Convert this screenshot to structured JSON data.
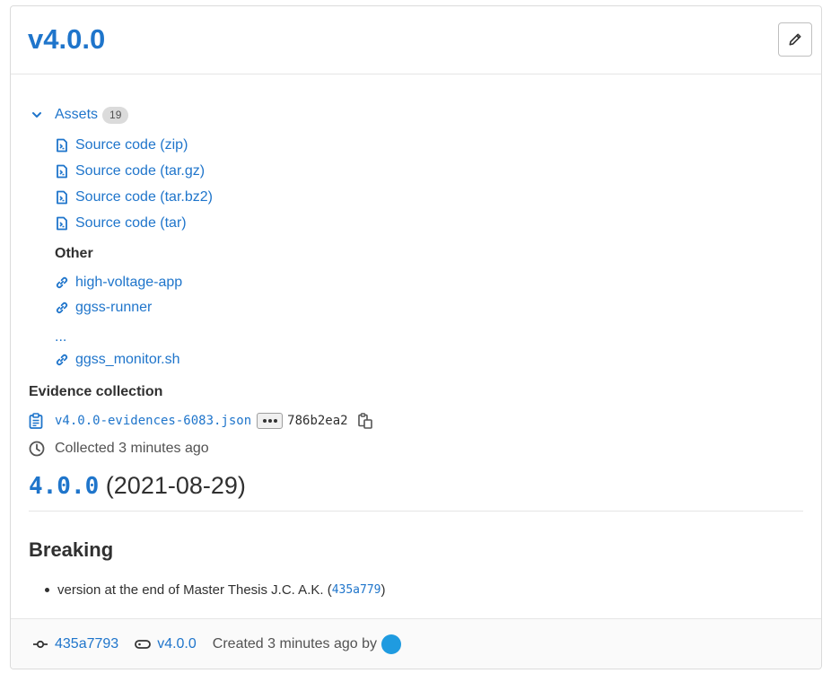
{
  "release": {
    "title": "v4.0.0",
    "edit_icon": "pencil-icon"
  },
  "assets": {
    "label": "Assets",
    "count": "19",
    "sources": [
      {
        "label": "Source code (zip)",
        "icon": "doc-code-icon"
      },
      {
        "label": "Source code (tar.gz)",
        "icon": "doc-code-icon"
      },
      {
        "label": "Source code (tar.bz2)",
        "icon": "doc-code-icon"
      },
      {
        "label": "Source code (tar)",
        "icon": "doc-code-icon"
      }
    ],
    "other_heading": "Other",
    "links": [
      {
        "label": "high-voltage-app",
        "icon": "link-icon"
      },
      {
        "label": "ggss-runner",
        "icon": "link-icon"
      },
      {
        "label": "ggss_monitor.sh",
        "icon": "link-icon"
      }
    ],
    "ellipsis": "..."
  },
  "evidence": {
    "heading": "Evidence collection",
    "file": "v4.0.0-evidences-6083.json",
    "hash": "786b2ea2",
    "collected": "Collected 3 minutes ago"
  },
  "notes": {
    "version": "4.0.0",
    "date": "(2021-08-29)",
    "breaking_heading": "Breaking",
    "item_text": "version at the end of Master Thesis J.C. A.K. (",
    "item_commit": "435a779",
    "item_close": ")"
  },
  "footer": {
    "commit": "435a7793",
    "tag": "v4.0.0",
    "created": "Created 3 minutes ago by"
  },
  "colors": {
    "link": "#1f75cb",
    "avatar": "#1f9be0"
  }
}
